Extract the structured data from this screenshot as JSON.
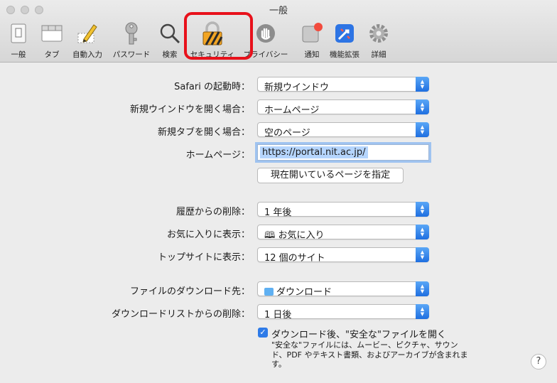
{
  "window": {
    "title": "一般"
  },
  "toolbar": {
    "items": [
      {
        "label": "一般",
        "icon": "switch-icon"
      },
      {
        "label": "タブ",
        "icon": "tabs-icon"
      },
      {
        "label": "自動入力",
        "icon": "pencil-icon"
      },
      {
        "label": "パスワード",
        "icon": "key-icon"
      },
      {
        "label": "検索",
        "icon": "magnifier-icon"
      },
      {
        "label": "セキュリティ",
        "icon": "lock-icon"
      },
      {
        "label": "プライバシー",
        "icon": "hand-icon"
      },
      {
        "label": "通知",
        "icon": "notification-icon"
      },
      {
        "label": "機能拡張",
        "icon": "puzzle-icon"
      },
      {
        "label": "詳細",
        "icon": "gear-icon"
      }
    ],
    "highlight_color": "#e8111b"
  },
  "settings": {
    "startup": {
      "label": "Safari の起動時：",
      "value": "新規ウインドウ"
    },
    "new_window": {
      "label": "新規ウインドウを開く場合：",
      "value": "ホームページ"
    },
    "new_tab": {
      "label": "新規タブを開く場合：",
      "value": "空のページ"
    },
    "homepage": {
      "label": "ホームページ：",
      "value": "https://portal.nit.ac.jp/"
    },
    "set_current_button": "現在開いているページを指定",
    "history_remove": {
      "label": "履歴からの削除：",
      "value": "1 年後"
    },
    "favorites_show": {
      "label": "お気に入りに表示：",
      "value": "お気に入り"
    },
    "topsites_show": {
      "label": "トップサイトに表示：",
      "value": "12 個のサイト"
    },
    "download_dest": {
      "label": "ファイルのダウンロード先：",
      "value": "ダウンロード"
    },
    "download_list_remove": {
      "label": "ダウンロードリストからの削除：",
      "value": "1 日後"
    },
    "open_safe": {
      "label": "ダウンロード後、\"安全な\"ファイルを開く",
      "checked": true
    },
    "safe_note": "\"安全な\"ファイルには、ムービー、ピクチャ、サウンド、PDF やテキスト書類、およびアーカイブが含まれます。"
  },
  "help": "?"
}
